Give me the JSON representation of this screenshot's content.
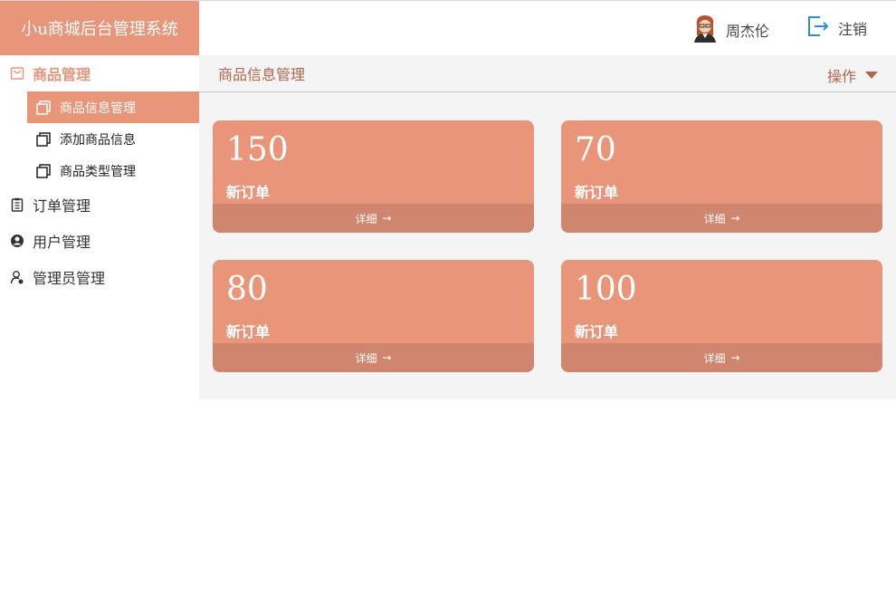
{
  "brand": {
    "title": "小u商城后台管理系统"
  },
  "header": {
    "user_name": "周杰伦",
    "logout_label": "注销"
  },
  "sidebar": {
    "groups": [
      {
        "label": "商品管理",
        "icon": "bag-icon",
        "active": true,
        "items": [
          {
            "label": "商品信息管理",
            "active": true
          },
          {
            "label": "添加商品信息",
            "active": false
          },
          {
            "label": "商品类型管理",
            "active": false
          }
        ]
      },
      {
        "label": "订单管理",
        "icon": "clipboard-icon"
      },
      {
        "label": "用户管理",
        "icon": "user-circle-icon"
      },
      {
        "label": "管理员管理",
        "icon": "admin-user-icon"
      }
    ]
  },
  "main": {
    "breadcrumb": "商品信息管理",
    "operations_label": "操作",
    "cards": [
      {
        "value": "150",
        "label": "新订单",
        "detail_label": "详细"
      },
      {
        "value": "70",
        "label": "新订单",
        "detail_label": "详细"
      },
      {
        "value": "80",
        "label": "新订单",
        "detail_label": "详细"
      },
      {
        "value": "100",
        "label": "新订单",
        "detail_label": "详细"
      }
    ]
  },
  "colors": {
    "accent": "#e8957a",
    "accent_dark": "#d0856e",
    "breadcrumb_text": "#b0654a",
    "content_bg": "#f4f4f4"
  }
}
